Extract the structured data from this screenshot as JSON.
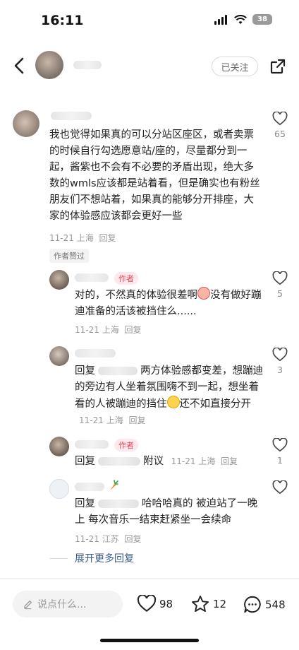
{
  "status_bar": {
    "time": "16:11",
    "battery": "38"
  },
  "header": {
    "follow_label": "已关注"
  },
  "main_comment": {
    "text": "我也觉得如果真的可以分站区座区，或者卖票的时候自行勾选愿意站/座的，尽量都分到一起，酱紫也不会有不必要的矛盾出现，绝大多数的wmls应该都是站着看，但是确实也有粉丝朋友们不想站着，如果真的能够分开排座，大家的体验感应该都会更好一些",
    "date": "11-21",
    "location": "上海",
    "reply_label": "回复",
    "like_count": "65",
    "author_approved": "作者赞过"
  },
  "replies": [
    {
      "author_tag": "作者",
      "text_before": "对的，不然真的体验很差啊",
      "text_after": "没有做好蹦迪准备的活该被挡住么......",
      "date": "11-21",
      "location": "上海",
      "reply_label": "回复",
      "like_count": "5"
    },
    {
      "prefix": "回复",
      "text_before": "两方体验感都变差，想蹦迪的旁边有人坐着氛围嗨不到一起，想坐着看的人被蹦迪的挡住",
      "text_after": "还不如直接分开",
      "date": "11-21",
      "location": "上海",
      "reply_label": "回复",
      "like_count": "3"
    },
    {
      "author_tag": "作者",
      "prefix": "回复",
      "text": "附议",
      "date": "11-21",
      "location": "上海",
      "reply_label": "回复",
      "like_count": "1"
    },
    {
      "prefix": "回复",
      "text": "哈哈哈真的 被迫站了一晚上 每次音乐一结束赶紧坐一会续命",
      "date": "11-21",
      "location": "江苏",
      "reply_label": "回复"
    }
  ],
  "expand_label": "展开更多回复",
  "bottom_bar": {
    "input_placeholder": "说点什么...",
    "likes": "98",
    "stars": "12",
    "comments": "548"
  },
  "icons": {
    "back": "back-arrow-icon",
    "share": "share-icon",
    "heart": "heart-icon",
    "star": "star-icon",
    "comment": "comment-bubble-icon",
    "pencil": "pencil-icon",
    "carrot": "carrot-icon"
  }
}
